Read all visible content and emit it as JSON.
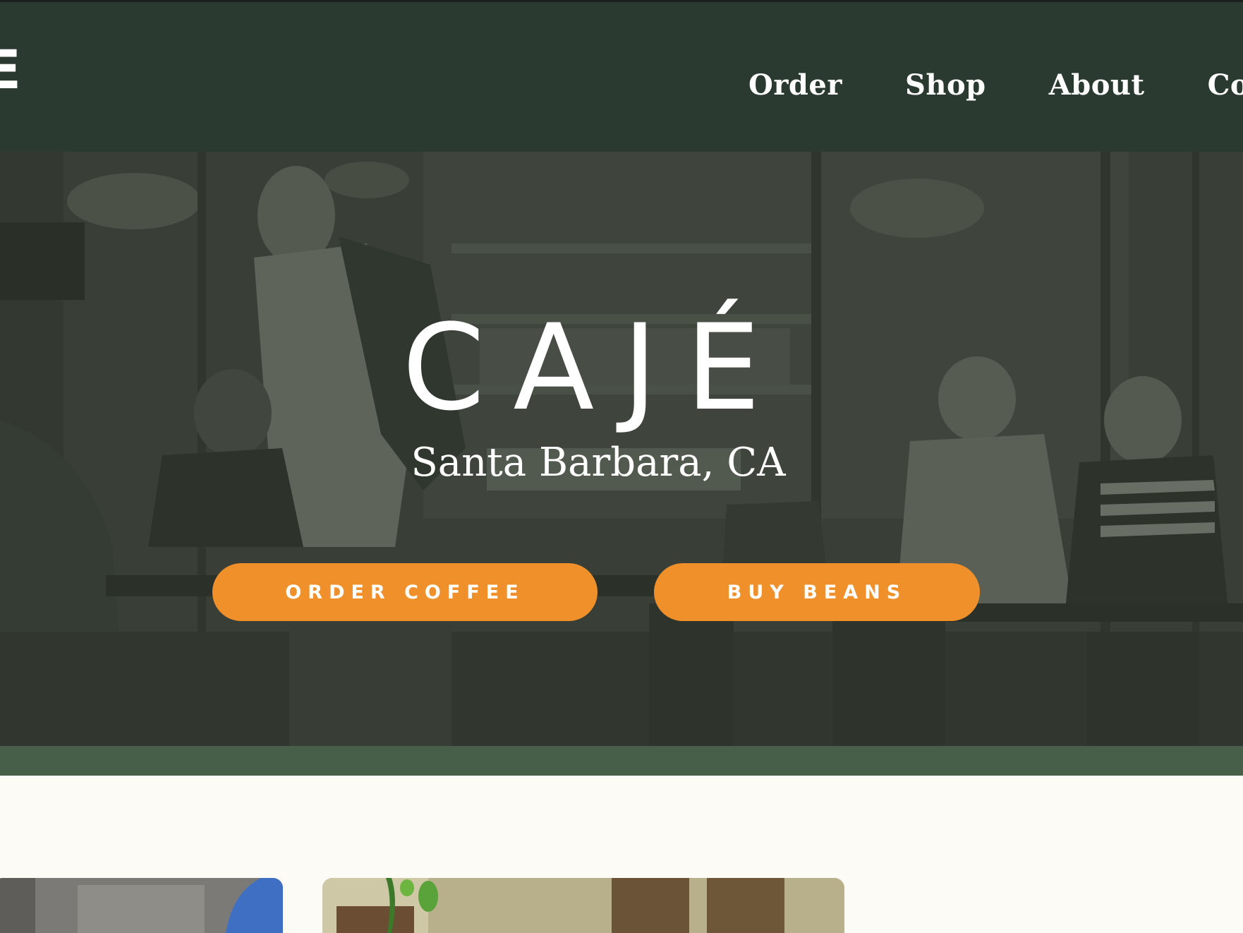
{
  "brand": {
    "logo_text": "E",
    "hero_title": "CAJÉ",
    "hero_subtitle": "Santa Barbara, CA"
  },
  "nav": {
    "items": [
      {
        "label": "Order"
      },
      {
        "label": "Shop"
      },
      {
        "label": "About"
      },
      {
        "label": "Contact"
      }
    ]
  },
  "hero": {
    "buttons": {
      "order_coffee": "ORDER COFFEE",
      "buy_beans": "BUY BEANS"
    }
  },
  "colors": {
    "header_bg": "#2b3a30",
    "accent_button": "#ef902b",
    "band": "#475f48",
    "page_bg": "#fdfbf6"
  }
}
